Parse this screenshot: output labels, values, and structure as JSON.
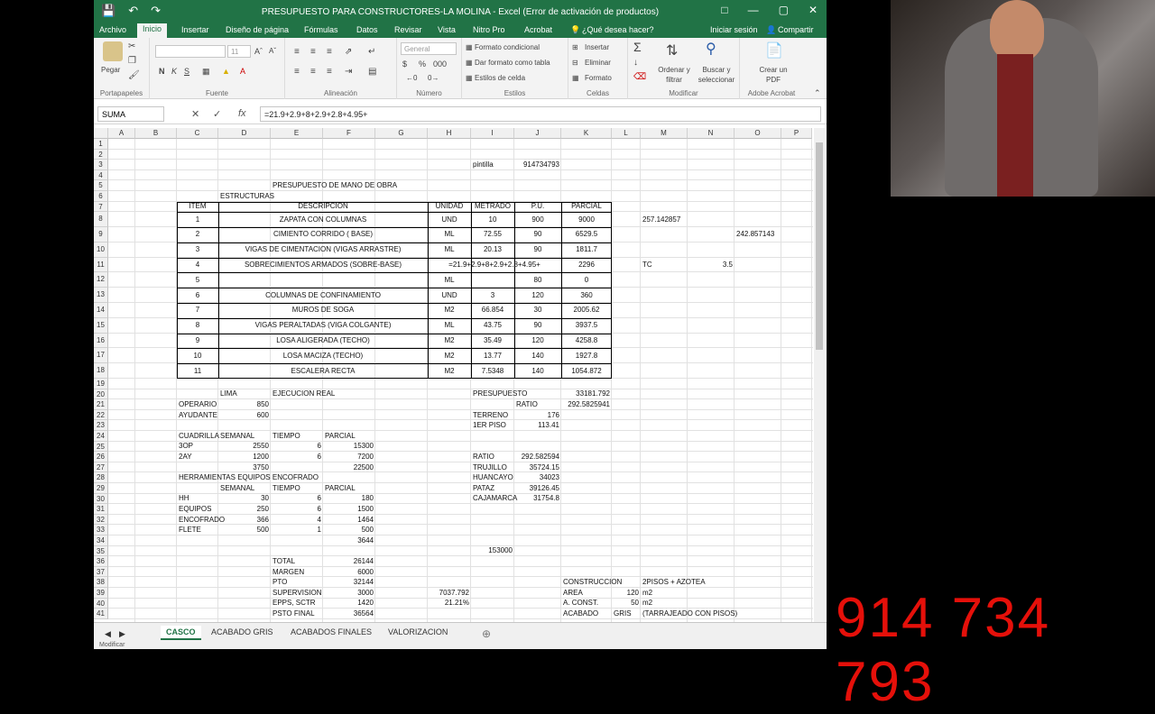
{
  "titlebar": {
    "title": "PRESUPUESTO PARA CONSTRUCTORES-LA MOLINA - Excel (Error de activación de productos)"
  },
  "tabs": [
    "Archivo",
    "Inicio",
    "Insertar",
    "Diseño de página",
    "Fórmulas",
    "Datos",
    "Revisar",
    "Vista",
    "Nitro Pro",
    "Acrobat"
  ],
  "tell_me": "¿Qué desea hacer?",
  "signin": "Iniciar sesión",
  "share": "Compartir",
  "ribbon": {
    "paste": "Pegar",
    "font_name": "",
    "font_size": "11",
    "number_format": "General",
    "cond_format": "Formato condicional",
    "table_format": "Dar formato como tabla",
    "cell_styles": "Estilos de celda",
    "insert": "Insertar",
    "delete": "Eliminar",
    "format": "Formato",
    "sort": "Ordenar y filtrar",
    "find": "Buscar y seleccionar",
    "pdf": "Crear un PDF",
    "groups": [
      "Portapapeles",
      "Fuente",
      "Alineación",
      "Número",
      "Estilos",
      "Celdas",
      "Modificar",
      "Adobe Acrobat"
    ]
  },
  "formula": {
    "namebox": "SUMA",
    "fx": "fx",
    "content": "=21.9+2.9+8+2.9+2.8+4.95+"
  },
  "columns": [
    "A",
    "B",
    "C",
    "D",
    "E",
    "F",
    "G",
    "H",
    "I",
    "J",
    "K",
    "L",
    "M",
    "N",
    "O",
    "P"
  ],
  "rows": [
    "1",
    "2",
    "3",
    "4",
    "5",
    "6",
    "7",
    "8",
    "9",
    "10",
    "11",
    "12",
    "13",
    "14",
    "15",
    "16",
    "17",
    "18",
    "19",
    "20",
    "21",
    "22",
    "23",
    "24",
    "25",
    "26",
    "27",
    "28",
    "29",
    "30",
    "31",
    "32",
    "33",
    "34",
    "35",
    "36",
    "37",
    "38",
    "39",
    "40",
    "41"
  ],
  "cells": {
    "pintilla": "pintilla",
    "pintilla_num": "914734793",
    "title": "PRESUPUESTO DE MANO DE OBRA",
    "estructuras": "ESTRUCTURAS",
    "hdr_item": "ITEM",
    "hdr_desc": "DESCRIPCION",
    "hdr_unidad": "UNIDAD",
    "hdr_metrado": "METRADO",
    "hdr_pu": "P.U.",
    "hdr_parcial": "PARCIAL",
    "items": [
      {
        "item": "1",
        "desc": "ZAPATA CON COLUMNAS",
        "unidad": "UND",
        "metrado": "10",
        "pu": "900",
        "parcial": "9000"
      },
      {
        "item": "2",
        "desc": "CIMIENTO CORRIDO ( BASE)",
        "unidad": "ML",
        "metrado": "72.55",
        "pu": "90",
        "parcial": "6529.5"
      },
      {
        "item": "3",
        "desc": "VIGAS DE CIMENTACION (VIGAS ARRASTRE)",
        "unidad": "ML",
        "metrado": "20.13",
        "pu": "90",
        "parcial": "1811.7"
      },
      {
        "item": "4",
        "desc": "SOBRECIMIENTOS ARMADOS (SOBRE-BASE)",
        "unidad": "",
        "metrado": "=21.9+2.9+8+2.9+2.8+4.95+",
        "pu": "",
        "parcial": "2296"
      },
      {
        "item": "5",
        "desc": "",
        "unidad": "ML",
        "metrado": "",
        "pu": "80",
        "parcial": "0"
      },
      {
        "item": "6",
        "desc": "COLUMNAS DE CONFINAMIENTO",
        "unidad": "UND",
        "metrado": "3",
        "pu": "120",
        "parcial": "360"
      },
      {
        "item": "7",
        "desc": "MUROS DE SOGA",
        "unidad": "M2",
        "metrado": "66.854",
        "pu": "30",
        "parcial": "2005.62"
      },
      {
        "item": "8",
        "desc": "VIGAS PERALTADAS (VIGA COLGANTE)",
        "unidad": "ML",
        "metrado": "43.75",
        "pu": "90",
        "parcial": "3937.5"
      },
      {
        "item": "9",
        "desc": "LOSA ALIGERADA (TECHO)",
        "unidad": "M2",
        "metrado": "35.49",
        "pu": "120",
        "parcial": "4258.8"
      },
      {
        "item": "10",
        "desc": "LOSA MACIZA (TECHO)",
        "unidad": "M2",
        "metrado": "13.77",
        "pu": "140",
        "parcial": "1927.8"
      },
      {
        "item": "11",
        "desc": "ESCALERA RECTA",
        "unidad": "M2",
        "metrado": "7.5348",
        "pu": "140",
        "parcial": "1054.872"
      }
    ],
    "m8": "257.142857",
    "o9": "242.857143",
    "m11": "TC",
    "n11": "3.5",
    "lima": "LIMA",
    "ejec": "EJECUCION REAL",
    "presupuesto": "PRESUPUESTO",
    "presupuesto_val": "33181.792",
    "ratio_lbl": "RATIO",
    "ratio_val": "292.5825941",
    "operario": "OPERARIO",
    "operario_v": "850",
    "ayudante": "AYUDANTE",
    "ayudante_v": "600",
    "terreno": "TERRENO",
    "terreno_v": "176",
    "piso1": "1ER PISO",
    "piso1_v": "113.41",
    "cuadrilla": "CUADRILLA",
    "semanal": "SEMANAL",
    "tiempo": "TIEMPO",
    "parcial": "PARCIAL",
    "op3": "3OP",
    "op3_s": "2550",
    "op3_t": "6",
    "op3_p": "15300",
    "ay2": "2AY",
    "ay2_s": "1200",
    "ay2_t": "6",
    "ay2_p": "7200",
    "r27d": "3750",
    "r27f": "22500",
    "ratio2": "RATIO",
    "ratio2_v": "292.582594",
    "trujillo": "TRUJILLO",
    "trujillo_v": "35724.15",
    "huancayo": "HUANCAYO",
    "huancayo_v": "34023",
    "herr": "HERRAMIENTAS EQUIPOS ENCOFRADO",
    "semanal2": "SEMANAL",
    "tiempo2": "TIEMPO",
    "parcial2": "PARCIAL",
    "pataz": "PATAZ",
    "pataz_v": "39126.45",
    "hh": "HH",
    "hh_s": "30",
    "hh_t": "6",
    "hh_p": "180",
    "cajamarca": "CAJAMARCA",
    "cajamarca_v": "31754.8",
    "equipos": "EQUIPOS",
    "equipos_s": "250",
    "equipos_t": "6",
    "equipos_p": "1500",
    "encofrado": "ENCOFRADO",
    "encofrado_s": "366",
    "encofrado_t": "4",
    "encofrado_p": "1464",
    "flete": "FLETE",
    "flete_s": "500",
    "flete_t": "1",
    "flete_p": "500",
    "r34f": "3644",
    "r35i": "153000",
    "total": "TOTAL",
    "total_v": "26144",
    "margen": "MARGEN",
    "margen_v": "6000",
    "pto": "PTO",
    "pto_v": "32144",
    "construccion": "CONSTRUCCION",
    "pisos": "2PISOS + AZOTEA",
    "supervision": "SUPERVISION",
    "supervision_v": "3000",
    "r39h": "7037.792",
    "area": "AREA",
    "area_v": "120",
    "m2a": "m2",
    "epps": "EPPS, SCTR",
    "epps_v": "1420",
    "r40h": "21.21%",
    "aconst": "A. CONST.",
    "aconst_v": "50",
    "m2b": "m2",
    "pstofinal": "PSTO FINAL",
    "pstofinal_v": "36564",
    "acabado": "ACABADO",
    "gris": "GRIS",
    "tarraj": "(TARRAJEADO CON PISOS)"
  },
  "sheets": [
    "CASCO",
    "ACABADO GRIS",
    "ACABADOS FINALES",
    "VALORIZACION"
  ],
  "status": "Modificar",
  "phone": "914 734 793"
}
